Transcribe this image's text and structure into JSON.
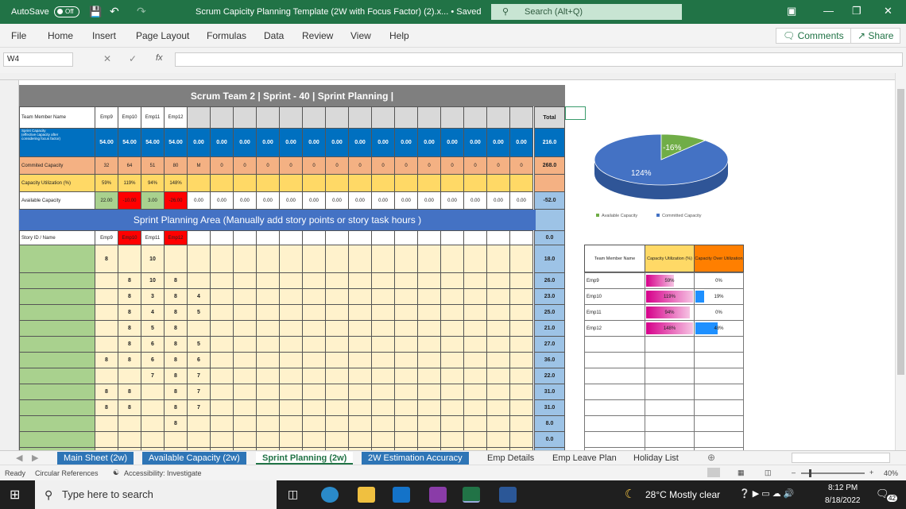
{
  "titlebar": {
    "autosave": "AutoSave",
    "toggle": "Off",
    "doc_title": "Scrum Capicity Planning Template (2W with Focus Factor) (2).x... • Saved",
    "search": "Search (Alt+Q)"
  },
  "ribbon": {
    "tabs": [
      "File",
      "Home",
      "Insert",
      "Page Layout",
      "Formulas",
      "Data",
      "Review",
      "View",
      "Help"
    ],
    "comments": "Comments",
    "share": "Share"
  },
  "formula": {
    "namebox": "W4",
    "fx": "fx",
    "value": ""
  },
  "sheet": {
    "banner": "Scrum Team 2 | Sprint - 40 | Sprint Planning |",
    "header_label": "Team Member Name",
    "members": [
      "Emp9",
      "Emp10",
      "Emp11",
      "Emp12"
    ],
    "total_label": "Total",
    "rows": {
      "capacity": {
        "label": "Sprint Capacity",
        "sub1": "(effective capacity after",
        "sub2": "considering focus factor)",
        "values": [
          "54.00",
          "54.00",
          "54.00",
          "54.00"
        ],
        "blank": "0.00",
        "total": "216.0"
      },
      "committed": {
        "label": "Commited Capacity",
        "values": [
          "32",
          "64",
          "51",
          "80"
        ],
        "other": "M",
        "blank": "0",
        "total": "268.0"
      },
      "utilization": {
        "label": "Capacity Utilization (%)",
        "values": [
          "59%",
          "119%",
          "94%",
          "148%"
        ]
      },
      "available": {
        "label": "Available Capacity",
        "values": [
          "22.00",
          "-10.00",
          "3.00",
          "-26.00"
        ],
        "blank": "0.00",
        "total": "-52.0"
      }
    },
    "planning_title": "Sprint Planning Area  (Manually add story points or story task hours )",
    "story_label": "Story ID / Name",
    "story_members": [
      "Emp9",
      "Emp10",
      "Emp11",
      "Emp12"
    ],
    "story_header_total": "0.0",
    "story_rows": [
      {
        "c": [
          "8",
          "",
          "10",
          "",
          ""
        ],
        "total": "18.0"
      },
      {
        "c": [
          "",
          "8",
          "10",
          "8",
          ""
        ],
        "total": "26.0"
      },
      {
        "c": [
          "",
          "8",
          "3",
          "8",
          "4"
        ],
        "total": "23.0"
      },
      {
        "c": [
          "",
          "8",
          "4",
          "8",
          "5"
        ],
        "total": "25.0"
      },
      {
        "c": [
          "",
          "8",
          "5",
          "8",
          ""
        ],
        "total": "21.0"
      },
      {
        "c": [
          "",
          "8",
          "6",
          "8",
          "5"
        ],
        "total": "27.0"
      },
      {
        "c": [
          "8",
          "8",
          "6",
          "8",
          "6"
        ],
        "total": "36.0"
      },
      {
        "c": [
          "",
          "",
          "7",
          "8",
          "7"
        ],
        "total": "22.0"
      },
      {
        "c": [
          "8",
          "8",
          "",
          "8",
          "7"
        ],
        "total": "31.0"
      },
      {
        "c": [
          "8",
          "8",
          "",
          "8",
          "7"
        ],
        "total": "31.0"
      },
      {
        "c": [
          "",
          "",
          "",
          "8",
          ""
        ],
        "total": "8.0"
      },
      {
        "c": [
          "",
          "",
          "",
          "",
          ""
        ],
        "total": "0.0"
      },
      {
        "c": [
          "",
          "",
          "",
          "",
          ""
        ],
        "total": "0.0"
      }
    ]
  },
  "pie": {
    "slices": [
      {
        "label": "124%",
        "value": 124,
        "color": "#4472c4"
      },
      {
        "label": "-16%",
        "value": 16,
        "color": "#70ad47"
      }
    ],
    "legend": [
      "Available Capacity",
      "Committed Capacity"
    ]
  },
  "side_table": {
    "headers": [
      "Team Member Name",
      "Capacity Utilization (%)",
      "Capacity Over Utilization"
    ],
    "rows": [
      {
        "name": "Emp9",
        "util": "59%",
        "util_v": 0.59,
        "over": "0%",
        "over_v": 0
      },
      {
        "name": "Emp10",
        "util": "119%",
        "util_v": 1.0,
        "over": "19%",
        "over_v": 0.19
      },
      {
        "name": "Emp11",
        "util": "94%",
        "util_v": 0.94,
        "over": "0%",
        "over_v": 0
      },
      {
        "name": "Emp12",
        "util": "148%",
        "util_v": 1.0,
        "over": "48%",
        "over_v": 0.48
      }
    ]
  },
  "tabs": [
    {
      "label": "Main Sheet (2w)",
      "style": "blue"
    },
    {
      "label": "Available Capacity (2w)",
      "style": "blue"
    },
    {
      "label": "Sprint Planning (2w)",
      "style": "active"
    },
    {
      "label": "2W Estimation Accuracy",
      "style": "blue"
    },
    {
      "label": "Emp Details",
      "style": "plain"
    },
    {
      "label": "Emp Leave Plan",
      "style": "plain"
    },
    {
      "label": "Holiday List",
      "style": "plain"
    }
  ],
  "status": {
    "ready": "Ready",
    "circular": "Circular References",
    "accessibility": "Accessibility: Investigate",
    "zoom": "40%"
  },
  "taskbar": {
    "search": "Type here to search",
    "weather": "28°C  Mostly clear",
    "time": "8:12 PM",
    "date": "8/18/2022",
    "notif": "42"
  },
  "colors": {
    "excel_green": "#217346",
    "header_blue": "#0070c0",
    "committed": "#f4b183",
    "util": "#ffd966",
    "planning_bar": "#4472c4",
    "story_green": "#a9d18e",
    "grid_cream": "#fff2cc",
    "total_blue": "#9dc3e6",
    "red": "#ff0000"
  }
}
